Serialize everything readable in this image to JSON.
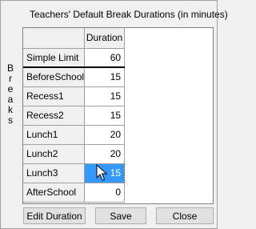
{
  "window": {
    "title": "Teachers' Default Break Durations (in minutes)"
  },
  "side_label": [
    "B",
    "r",
    "e",
    "a",
    "k",
    "s"
  ],
  "grid": {
    "column_header": "Duration",
    "rows": [
      {
        "label": "Simple Limit",
        "value": "60"
      },
      {
        "label": "BeforeSchool",
        "value": "15"
      },
      {
        "label": "Recess1",
        "value": "15"
      },
      {
        "label": "Recess2",
        "value": "15"
      },
      {
        "label": "Lunch1",
        "value": "20"
      },
      {
        "label": "Lunch2",
        "value": "20"
      },
      {
        "label": "Lunch3",
        "value": "15"
      },
      {
        "label": "AfterSchool",
        "value": "0"
      }
    ],
    "selected_row": "Lunch3"
  },
  "buttons": {
    "edit": "Edit Duration",
    "save": "Save",
    "close": "Close"
  },
  "colors": {
    "selection": "#3399ff",
    "background": "#f0f0f0"
  }
}
